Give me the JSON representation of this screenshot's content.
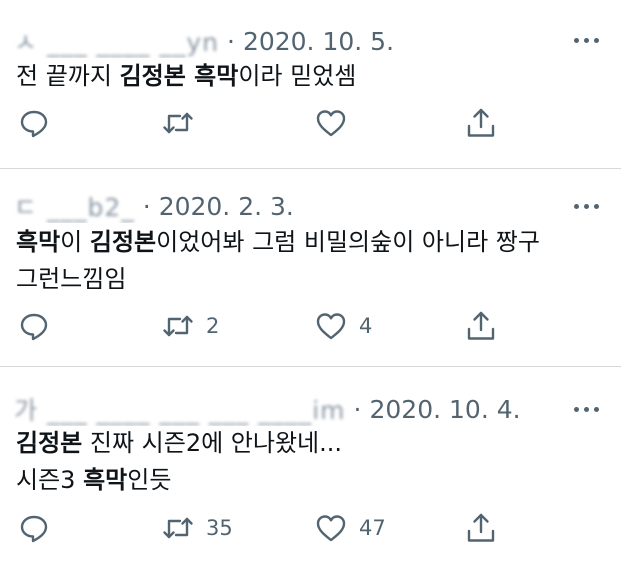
{
  "tweets": [
    {
      "handle": "ㅅ  ___ ____ __yn",
      "handle_tail": "n",
      "date": "2020. 10. 5.",
      "line1_a": "전 끝까지 ",
      "line1_b": "김정본 흑막",
      "line1_c": "이라 믿었셈",
      "replies": "",
      "retweets": "",
      "likes": ""
    },
    {
      "handle": "ㄷ  ___b2_",
      "date": "2020. 2. 3.",
      "line1_a": "흑막",
      "line1_b": "이 ",
      "line1_c": "김정본",
      "line1_d": "이었어봐 그럼 비밀의숲이 아니라 짱구",
      "line2": "그런느낌임",
      "retweets": "2",
      "likes": "4"
    },
    {
      "handle": "가 ___ ____ ___ ___ ____im",
      "date": "2020. 10. 4.",
      "line1_a": "김정본",
      "line1_b": " 진짜 시즌2에 안나왔네...",
      "line2_a": "시즌3 ",
      "line2_b": "흑막",
      "line2_c": "인듯",
      "retweets": "35",
      "likes": "47"
    }
  ],
  "separator": "·",
  "icons": [
    "more-icon",
    "reply-icon",
    "retweet-icon",
    "like-icon",
    "share-icon"
  ],
  "colors": {
    "text": "#0f1419",
    "secondary": "#536471",
    "divider": "#d6d9dc"
  }
}
